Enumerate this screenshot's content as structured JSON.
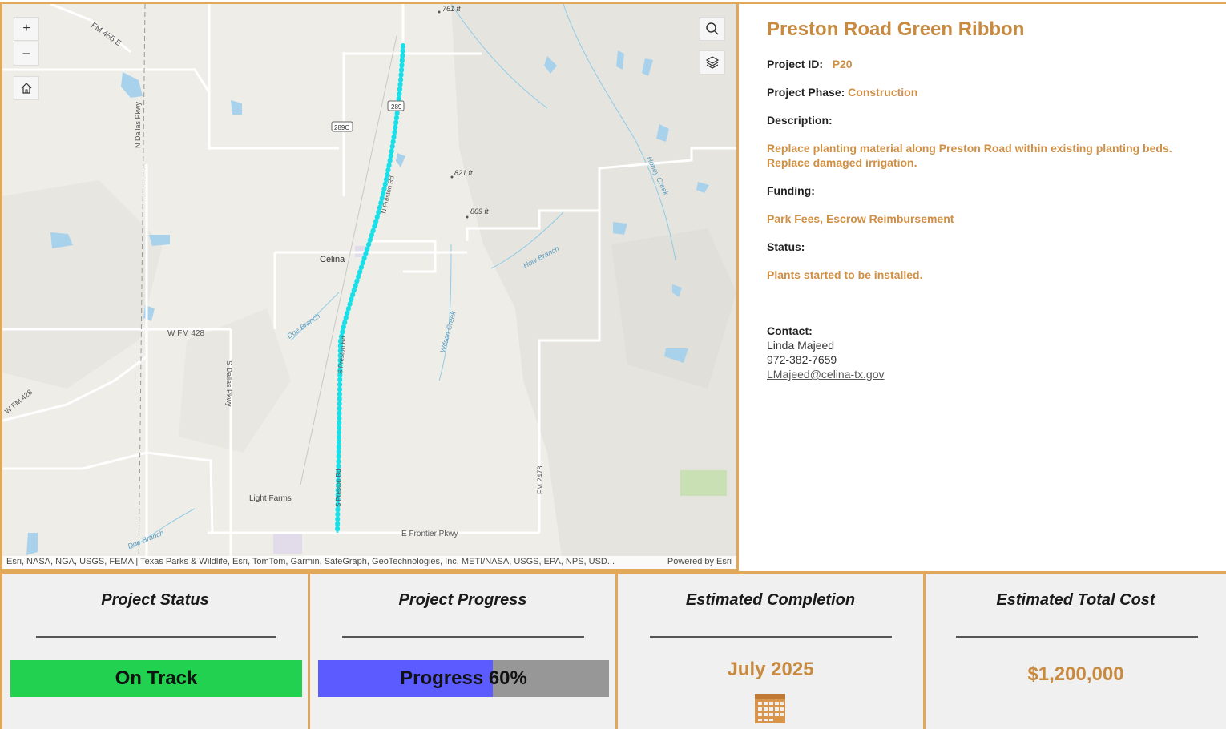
{
  "map": {
    "zoom_in": "+",
    "zoom_out": "–",
    "home_icon": "home-icon",
    "search_icon": "search-icon",
    "layers_icon": "layers-icon",
    "attribution": "Esri, NASA, NGA, USGS, FEMA | Texas Parks & Wildlife, Esri, TomTom, Garmin, SafeGraph, GeoTechnologies, Inc, METI/NASA, USGS, EPA, NPS, USD...",
    "powered_by": "Powered by Esri",
    "labels": {
      "fm455": "FM 455 E",
      "elev761": "761 ft",
      "elev821": "821 ft",
      "elev809": "809 ft",
      "celina": "Celina",
      "ndallas": "N Dallas Pkwy",
      "sdallas": "S Dallas Pkwy",
      "wfm428a": "W FM 428",
      "wfm428b": "W FM 428",
      "doebranch1": "Doe Branch",
      "doebranch2": "Doe Branch",
      "wilson": "Wilson Creek",
      "howbranch": "How Branch",
      "honeycreek": "Honey Creek",
      "lightfarms": "Light Farms",
      "frontier": "E Frontier Pkwy",
      "fm2478": "FM 2478",
      "r289": "289",
      "r289c": "289C",
      "preston_n": "N Preston Rd",
      "preston_s1": "S Preston Rd",
      "preston_s2": "S Preston Rd"
    }
  },
  "details": {
    "title": "Preston Road Green Ribbon",
    "project_id_label": "Project ID:",
    "project_id": "P20",
    "phase_label": "Project Phase:",
    "phase": "Construction",
    "description_label": "Description:",
    "description_line1": "Replace planting material along Preston Road within existing planting beds.",
    "description_line2": "Replace damaged irrigation.",
    "funding_label": "Funding:",
    "funding": "Park Fees, Escrow Reimbursement",
    "status_label": "Status:",
    "status": "Plants started to be installed.",
    "contact_label": "Contact:",
    "contact_name": "Linda Majeed",
    "contact_phone": "972-382-7659",
    "contact_email": "LMajeed@celina-tx.gov"
  },
  "cards": {
    "status_title": "Project Status",
    "status_value": "On Track",
    "progress_title": "Project Progress",
    "progress_text": "Progress 60%",
    "progress_fraction": 0.6,
    "completion_title": "Estimated Completion",
    "completion_value": "July 2025",
    "calendar_icon": "calendar-icon",
    "cost_title": "Estimated Total Cost",
    "cost_value": "$1,200,000"
  },
  "colors": {
    "accent": "#e0a858",
    "title_orange": "#c88a3e",
    "on_track_green": "#22d14f",
    "progress_blue": "#5b5bff",
    "route_cyan": "#19e0e8"
  }
}
